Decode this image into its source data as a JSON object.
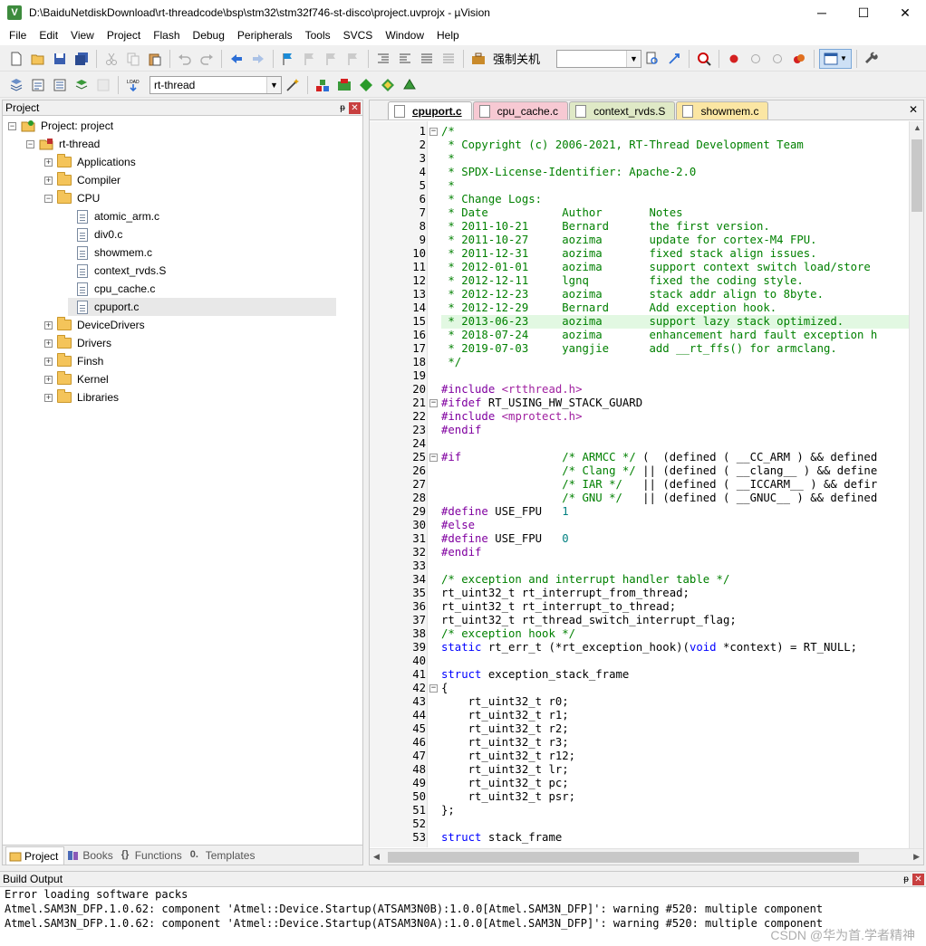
{
  "window": {
    "title": "D:\\BaiduNetdiskDownload\\rt-threadcode\\bsp\\stm32\\stm32f746-st-disco\\project.uvprojx - µVision",
    "app_icon_letter": "V",
    "controls": [
      "─",
      "☐",
      "✕"
    ]
  },
  "menu": [
    "File",
    "Edit",
    "View",
    "Project",
    "Flash",
    "Debug",
    "Peripherals",
    "Tools",
    "SVCS",
    "Window",
    "Help"
  ],
  "toolbar": {
    "shutdown_label": "强制关机",
    "target": "rt-thread",
    "load_label": "LOAD"
  },
  "project_pane": {
    "title": "Project",
    "pin": "ᵽ",
    "close": "✕",
    "tree": [
      {
        "label": "Project: project",
        "depth": 0,
        "kind": "project",
        "exp": "−"
      },
      {
        "label": "rt-thread",
        "depth": 1,
        "kind": "target",
        "exp": "−"
      },
      {
        "label": "Applications",
        "depth": 2,
        "kind": "folder",
        "exp": "+"
      },
      {
        "label": "Compiler",
        "depth": 2,
        "kind": "folder",
        "exp": "+"
      },
      {
        "label": "CPU",
        "depth": 2,
        "kind": "folder",
        "exp": "−"
      },
      {
        "label": "atomic_arm.c",
        "depth": 3,
        "kind": "file"
      },
      {
        "label": "div0.c",
        "depth": 3,
        "kind": "file"
      },
      {
        "label": "showmem.c",
        "depth": 3,
        "kind": "file"
      },
      {
        "label": "context_rvds.S",
        "depth": 3,
        "kind": "file"
      },
      {
        "label": "cpu_cache.c",
        "depth": 3,
        "kind": "file"
      },
      {
        "label": "cpuport.c",
        "depth": 3,
        "kind": "file",
        "selected": true
      },
      {
        "label": "DeviceDrivers",
        "depth": 2,
        "kind": "folder",
        "exp": "+"
      },
      {
        "label": "Drivers",
        "depth": 2,
        "kind": "folder",
        "exp": "+"
      },
      {
        "label": "Finsh",
        "depth": 2,
        "kind": "folder",
        "exp": "+"
      },
      {
        "label": "Kernel",
        "depth": 2,
        "kind": "folder",
        "exp": "+"
      },
      {
        "label": "Libraries",
        "depth": 2,
        "kind": "folder",
        "exp": "+"
      }
    ],
    "bottom_tabs": [
      "Project",
      "Books",
      "Functions",
      "Templates"
    ]
  },
  "editor": {
    "tabs": [
      {
        "label": "cpuport.c",
        "color": "#ffffff",
        "active": true
      },
      {
        "label": "cpu_cache.c",
        "color": "#f7c9d3"
      },
      {
        "label": "context_rvds.S",
        "color": "#dfe9c6"
      },
      {
        "label": "showmem.c",
        "color": "#fbe6a3"
      }
    ],
    "close": "✕",
    "highlight_line": 15,
    "lines": [
      {
        "n": 1,
        "fold": "−",
        "s": [
          [
            "/*",
            "cm"
          ]
        ]
      },
      {
        "n": 2,
        "s": [
          [
            " * Copyright (c) 2006-2021, RT-Thread Development Team",
            "cm"
          ]
        ]
      },
      {
        "n": 3,
        "s": [
          [
            " *",
            "cm"
          ]
        ]
      },
      {
        "n": 4,
        "s": [
          [
            " * SPDX-License-Identifier: Apache-2.0",
            "cm"
          ]
        ]
      },
      {
        "n": 5,
        "s": [
          [
            " *",
            "cm"
          ]
        ]
      },
      {
        "n": 6,
        "s": [
          [
            " * Change Logs:",
            "cm"
          ]
        ]
      },
      {
        "n": 7,
        "s": [
          [
            " * Date           Author       Notes",
            "cm"
          ]
        ]
      },
      {
        "n": 8,
        "s": [
          [
            " * 2011-10-21     Bernard      the first version.",
            "cm"
          ]
        ]
      },
      {
        "n": 9,
        "s": [
          [
            " * 2011-10-27     aozima       update for cortex-M4 FPU.",
            "cm"
          ]
        ]
      },
      {
        "n": 10,
        "s": [
          [
            " * 2011-12-31     aozima       fixed stack align issues.",
            "cm"
          ]
        ]
      },
      {
        "n": 11,
        "s": [
          [
            " * 2012-01-01     aozima       support context switch load/store",
            "cm"
          ]
        ]
      },
      {
        "n": 12,
        "s": [
          [
            " * 2012-12-11     lgnq         fixed the coding style.",
            "cm"
          ]
        ]
      },
      {
        "n": 13,
        "s": [
          [
            " * 2012-12-23     aozima       stack addr align to 8byte.",
            "cm"
          ]
        ]
      },
      {
        "n": 14,
        "s": [
          [
            " * 2012-12-29     Bernard      Add exception hook.",
            "cm"
          ]
        ]
      },
      {
        "n": 15,
        "s": [
          [
            " * 2013-06-23     aozima       support lazy stack optimized.",
            "cm"
          ]
        ]
      },
      {
        "n": 16,
        "s": [
          [
            " * 2018-07-24     aozima       enhancement hard fault exception h",
            "cm"
          ]
        ]
      },
      {
        "n": 17,
        "s": [
          [
            " * 2019-07-03     yangjie      add __rt_ffs() for armclang.",
            "cm"
          ]
        ]
      },
      {
        "n": 18,
        "s": [
          [
            " */",
            "cm"
          ]
        ]
      },
      {
        "n": 19,
        "s": []
      },
      {
        "n": 20,
        "s": [
          [
            "#include ",
            "pp"
          ],
          [
            "<rtthread.h>",
            "str"
          ]
        ]
      },
      {
        "n": 21,
        "fold": "−",
        "s": [
          [
            "#ifdef ",
            "pp"
          ],
          [
            "RT_USING_HW_STACK_GUARD",
            ""
          ]
        ]
      },
      {
        "n": 22,
        "s": [
          [
            "#include ",
            "pp"
          ],
          [
            "<mprotect.h>",
            "str"
          ]
        ]
      },
      {
        "n": 23,
        "s": [
          [
            "#endif",
            "pp"
          ]
        ]
      },
      {
        "n": 24,
        "s": []
      },
      {
        "n": 25,
        "fold": "−",
        "s": [
          [
            "#if",
            "pp"
          ],
          [
            "               ",
            ""
          ],
          [
            "/* ARMCC */",
            "cm"
          ],
          [
            " (  (defined ( __CC_ARM ) && defined",
            ""
          ]
        ]
      },
      {
        "n": 26,
        "s": [
          [
            "                  ",
            ""
          ],
          [
            "/* Clang */",
            "cm"
          ],
          [
            " || (defined ( __clang__ ) && define",
            ""
          ]
        ]
      },
      {
        "n": 27,
        "s": [
          [
            "                  ",
            ""
          ],
          [
            "/* IAR */",
            "cm"
          ],
          [
            "   || (defined ( __ICCARM__ ) && defir",
            ""
          ]
        ]
      },
      {
        "n": 28,
        "s": [
          [
            "                  ",
            ""
          ],
          [
            "/* GNU */",
            "cm"
          ],
          [
            "   || (defined ( __GNUC__ ) && defined",
            ""
          ]
        ]
      },
      {
        "n": 29,
        "s": [
          [
            "#define ",
            "pp"
          ],
          [
            "USE_FPU   ",
            ""
          ],
          [
            "1",
            "num"
          ]
        ]
      },
      {
        "n": 30,
        "s": [
          [
            "#else",
            "pp"
          ]
        ]
      },
      {
        "n": 31,
        "s": [
          [
            "#define ",
            "pp"
          ],
          [
            "USE_FPU   ",
            ""
          ],
          [
            "0",
            "num"
          ]
        ]
      },
      {
        "n": 32,
        "s": [
          [
            "#endif",
            "pp"
          ]
        ]
      },
      {
        "n": 33,
        "s": []
      },
      {
        "n": 34,
        "s": [
          [
            "/* exception and interrupt handler table */",
            "cm"
          ]
        ]
      },
      {
        "n": 35,
        "s": [
          [
            "rt_uint32_t rt_interrupt_from_thread;",
            ""
          ]
        ]
      },
      {
        "n": 36,
        "s": [
          [
            "rt_uint32_t rt_interrupt_to_thread;",
            ""
          ]
        ]
      },
      {
        "n": 37,
        "s": [
          [
            "rt_uint32_t rt_thread_switch_interrupt_flag;",
            ""
          ]
        ]
      },
      {
        "n": 38,
        "s": [
          [
            "/* exception hook */",
            "cm"
          ]
        ]
      },
      {
        "n": 39,
        "s": [
          [
            "static",
            "kw"
          ],
          [
            " rt_err_t (*rt_exception_hook)(",
            ""
          ],
          [
            "void",
            "kw"
          ],
          [
            " *context) = RT_NULL;",
            ""
          ]
        ]
      },
      {
        "n": 40,
        "s": []
      },
      {
        "n": 41,
        "s": [
          [
            "struct",
            "kw"
          ],
          [
            " exception_stack_frame",
            ""
          ]
        ]
      },
      {
        "n": 42,
        "fold": "−",
        "s": [
          [
            "{",
            ""
          ]
        ]
      },
      {
        "n": 43,
        "s": [
          [
            "    rt_uint32_t r0;",
            ""
          ]
        ]
      },
      {
        "n": 44,
        "s": [
          [
            "    rt_uint32_t r1;",
            ""
          ]
        ]
      },
      {
        "n": 45,
        "s": [
          [
            "    rt_uint32_t r2;",
            ""
          ]
        ]
      },
      {
        "n": 46,
        "s": [
          [
            "    rt_uint32_t r3;",
            ""
          ]
        ]
      },
      {
        "n": 47,
        "s": [
          [
            "    rt_uint32_t r12;",
            ""
          ]
        ]
      },
      {
        "n": 48,
        "s": [
          [
            "    rt_uint32_t lr;",
            ""
          ]
        ]
      },
      {
        "n": 49,
        "s": [
          [
            "    rt_uint32_t pc;",
            ""
          ]
        ]
      },
      {
        "n": 50,
        "s": [
          [
            "    rt_uint32_t psr;",
            ""
          ]
        ]
      },
      {
        "n": 51,
        "s": [
          [
            "};",
            ""
          ]
        ]
      },
      {
        "n": 52,
        "s": []
      },
      {
        "n": 53,
        "s": [
          [
            "struct",
            "kw"
          ],
          [
            " stack_frame",
            ""
          ]
        ]
      }
    ]
  },
  "build_output": {
    "title": "Build Output",
    "lines": [
      "Error loading software packs",
      "Atmel.SAM3N_DFP.1.0.62: component 'Atmel::Device.Startup(ATSAM3N0B):1.0.0[Atmel.SAM3N_DFP]': warning #520: multiple component",
      "Atmel.SAM3N_DFP.1.0.62: component 'Atmel::Device.Startup(ATSAM3N0A):1.0.0[Atmel.SAM3N_DFP]': warning #520: multiple component"
    ],
    "watermark": "CSDN @华为首.学者精神"
  }
}
